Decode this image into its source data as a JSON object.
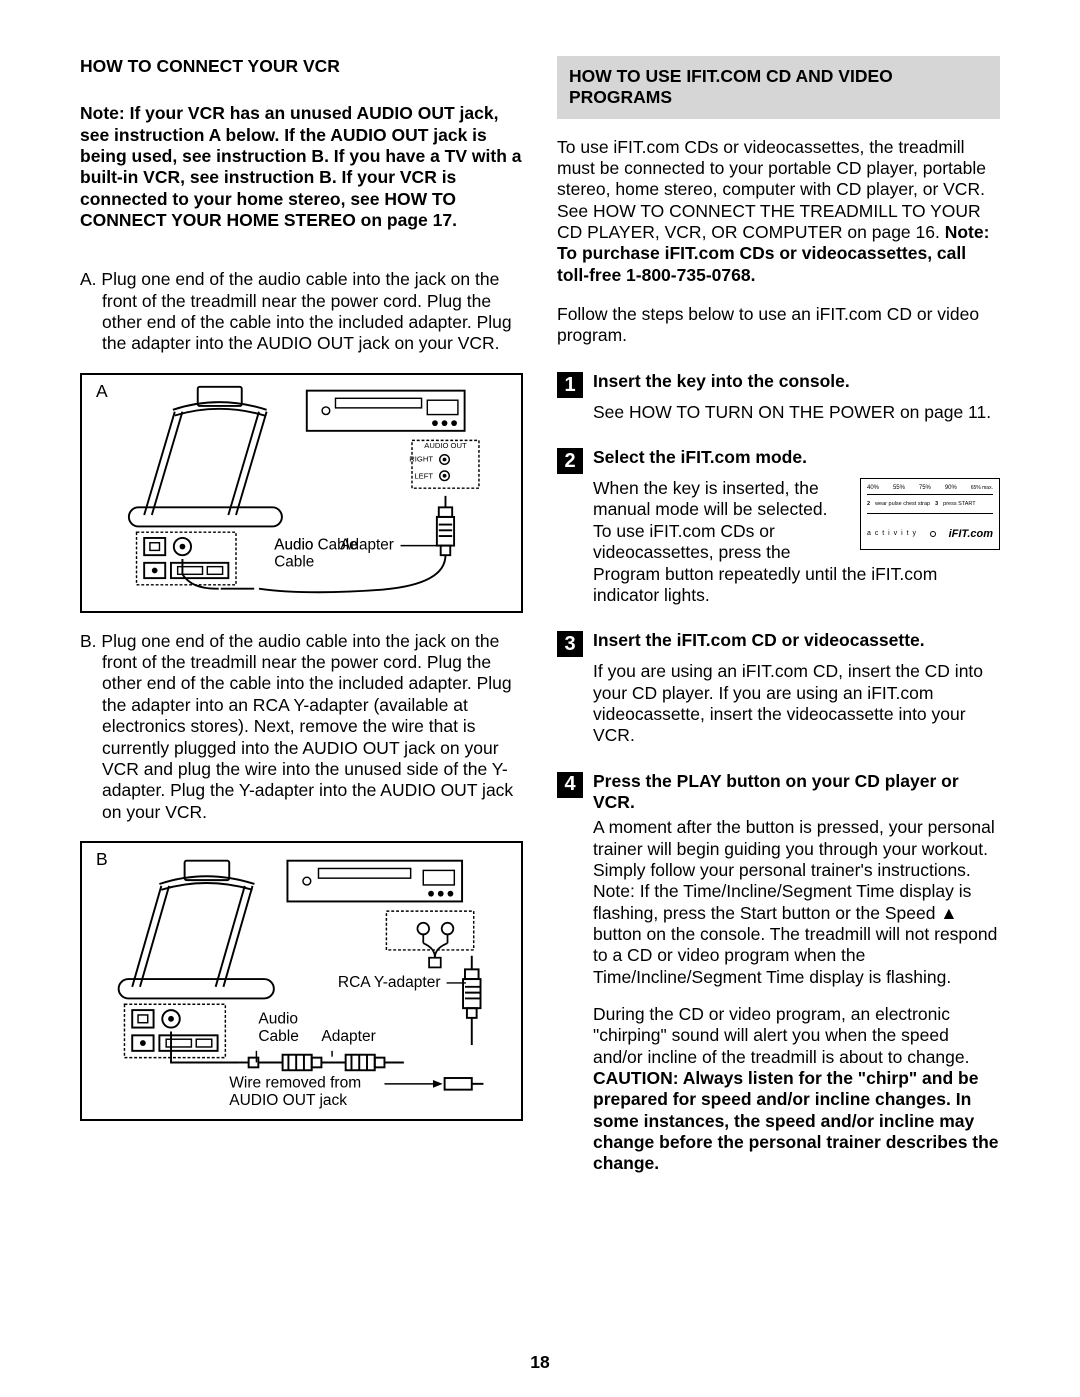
{
  "left": {
    "heading": "HOW TO CONNECT YOUR VCR",
    "note": "Note: If your VCR has an unused AUDIO OUT jack, see instruction A below. If the AUDIO OUT jack is being used, see instruction B. If you have a TV with a built-in VCR, see instruction B. If your VCR is connected to your home stereo, see HOW TO CONNECT YOUR HOME STEREO on page 17.",
    "item_a": "A. Plug one end of the audio cable into the jack on the front of the treadmill near the power cord. Plug the other end of the cable into the included adapter. Plug the adapter into the AUDIO OUT jack on your VCR.",
    "item_b": "B. Plug one end of the audio cable into the jack on the front of the treadmill near the power cord. Plug the other end of the cable into the included adapter. Plug the adapter into an RCA Y-adapter (available at electronics stores). Next, remove the wire that is currently plugged into the AUDIO OUT jack on your VCR and plug the wire into the unused side of the Y-adapter. Plug the Y-adapter into the AUDIO OUT jack on your VCR.",
    "figA": {
      "label": "A",
      "audio_out": "AUDIO OUT",
      "right": "RIGHT",
      "left": "LEFT",
      "audio_cable": "Audio Cable",
      "adapter": "Adapter"
    },
    "figB": {
      "label": "B",
      "audio_cable": "Audio Cable",
      "adapter": "Adapter",
      "rca": "RCA Y-adapter",
      "wire": "Wire removed from AUDIO OUT jack"
    }
  },
  "right": {
    "header": "HOW TO USE IFIT.COM CD AND VIDEO PROGRAMS",
    "intro1": "To use iFIT.com CDs or videocassettes, the treadmill must be connected to your portable CD player, portable stereo, home stereo, computer with CD player, or VCR. See HOW TO CONNECT THE TREADMILL TO YOUR CD PLAYER, VCR, OR COMPUTER on page 16. ",
    "intro1_bold": "Note: To purchase iFIT.com CDs or videocassettes, call toll-free 1-800-735-0768.",
    "intro2": "Follow the steps below to use an iFIT.com CD or video program.",
    "step1_num": "1",
    "step1_title": "Insert the key into the console.",
    "step1_body": "See HOW TO TURN ON THE POWER on page 11.",
    "step2_num": "2",
    "step2_title": "Select the iFIT.com mode.",
    "step2_body": "When the key is inserted, the manual mode will be selected. To use iFIT.com CDs or videocassettes, press the Program button repeatedly until the iFIT.com indicator lights.",
    "console": {
      "t40": "40%",
      "t55": "55%",
      "t75": "75%",
      "t90": "90%",
      "row2_2": "2",
      "row2_a": "wear pulse chest strap",
      "row2_3": "3",
      "row2_b": "press START",
      "activity": "a c t i v i t y",
      "logo": "iFIT.com"
    },
    "step3_num": "3",
    "step3_title": "Insert the iFIT.com CD or videocassette.",
    "step3_body": "If you are using an iFIT.com CD, insert the CD into your CD player. If you are using an iFIT.com videocassette, insert the videocassette into your VCR.",
    "step4_num": "4",
    "step4_title": "Press the PLAY button on your CD player or VCR.",
    "step4_p1": "A moment after the button is pressed, your personal trainer will begin guiding you through your workout. Simply follow your personal trainer's instructions. Note: If the Time/Incline/Segment Time display is flashing, press the Start button or the Speed ▲ button on the console. The treadmill will not respond to a CD or video program when the Time/Incline/Segment Time display is flashing.",
    "step4_p2_a": "During the CD or video program, an electronic \"chirping\" sound will alert you when the speed and/or incline of the treadmill is about to change. ",
    "step4_p2_b": "CAUTION: Always listen for the \"chirp\" and be prepared for speed and/or incline changes. In some instances, the speed and/or incline may change before the personal trainer describes the change."
  },
  "page_number": "18"
}
